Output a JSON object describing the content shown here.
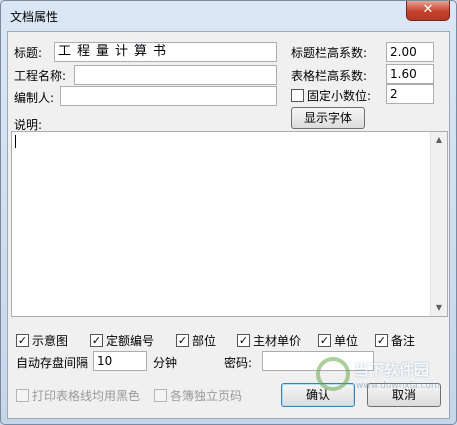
{
  "window": {
    "title": "文档属性",
    "close_label": "✕"
  },
  "form": {
    "title_label": "标题:",
    "title_value": "工程量计算书",
    "project_label": "工程名称:",
    "project_value": "",
    "author_label": "编制人:",
    "author_value": "",
    "desc_label": "说明:",
    "desc_value": "",
    "title_height_label": "标题栏高系数:",
    "title_height_value": "2.00",
    "table_height_label": "表格栏高系数:",
    "table_height_value": "1.60",
    "fixed_decimal_label": "固定小数位:",
    "fixed_decimal_value": "2",
    "fixed_decimal_checked": false,
    "show_font_label": "显示字体",
    "autosave_label": "自动存盘间隔",
    "autosave_value": "10",
    "autosave_unit": "分钟",
    "password_label": "密码:",
    "password_value": ""
  },
  "options": [
    {
      "label": "示意图",
      "checked": true
    },
    {
      "label": "定额编号",
      "checked": true
    },
    {
      "label": "部位",
      "checked": true
    },
    {
      "label": "主材单价",
      "checked": true
    },
    {
      "label": "单位",
      "checked": true
    },
    {
      "label": "备注",
      "checked": true
    }
  ],
  "bottom": {
    "print_black_label": "打印表格线均用黑色",
    "independent_page_label": "各簿独立页码",
    "ok_label": "确认",
    "cancel_label": "取消"
  },
  "watermark": {
    "text": "当下软件园",
    "sub": "www.downxia.com"
  }
}
